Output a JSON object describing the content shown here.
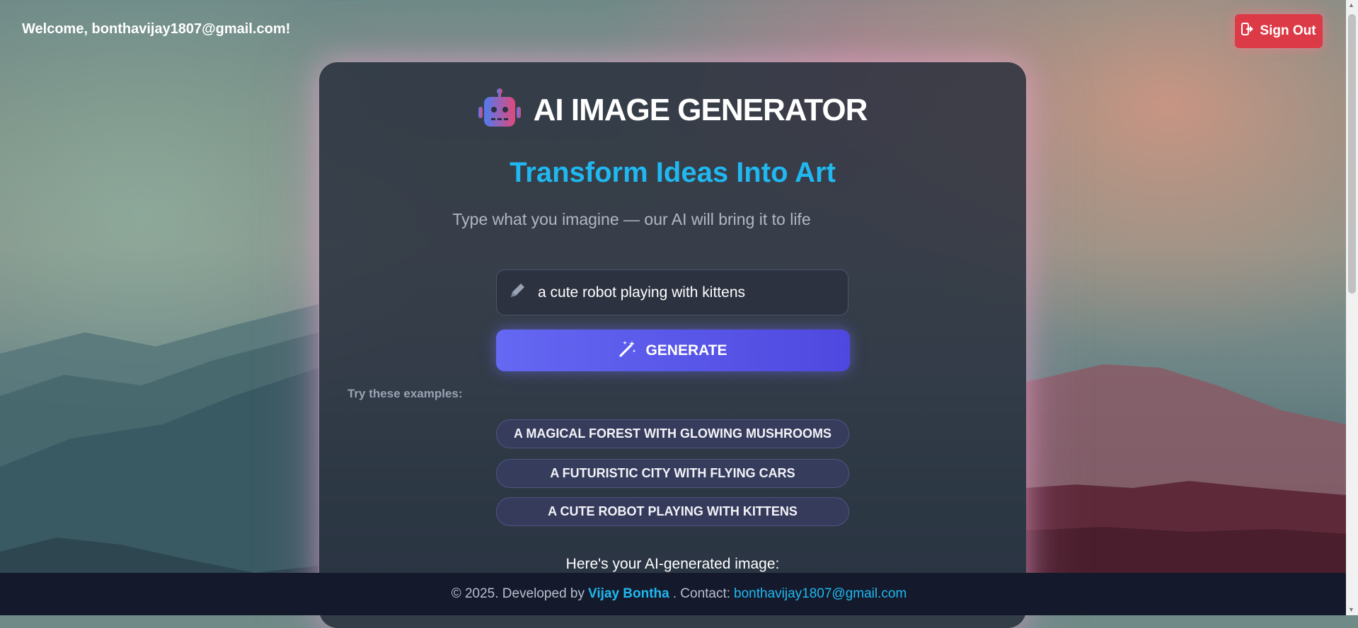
{
  "header": {
    "welcome": "Welcome, bonthavijay1807@gmail.com!",
    "sign_out_label": "Sign Out"
  },
  "app": {
    "title": "AI IMAGE GENERATOR",
    "headline": "Transform Ideas Into Art",
    "subheadline": "Type what you imagine — our AI will bring it to life"
  },
  "prompt": {
    "value": "a cute robot playing with kittens"
  },
  "generate_label": "GENERATE",
  "examples": {
    "label": "Try these examples:",
    "items": [
      "A MAGICAL FOREST WITH GLOWING MUSHROOMS",
      "A FUTURISTIC CITY WITH FLYING CARS",
      "A CUTE ROBOT PLAYING WITH KITTENS"
    ]
  },
  "result_label": "Here's your AI-generated image:",
  "footer": {
    "copyright": "© 2025. Developed by",
    "author": "Vijay Bontha",
    "contact_label": ". Contact:",
    "email": "bonthavijay1807@gmail.com"
  },
  "colors": {
    "accent": "#20b8f0",
    "generate": "#5b5ef0",
    "sign_out": "#dc3a46"
  },
  "icons": {
    "logo": "robot-icon",
    "sign_out": "sign-out-icon",
    "prompt": "pencil-icon",
    "generate": "magic-wand-icon"
  }
}
